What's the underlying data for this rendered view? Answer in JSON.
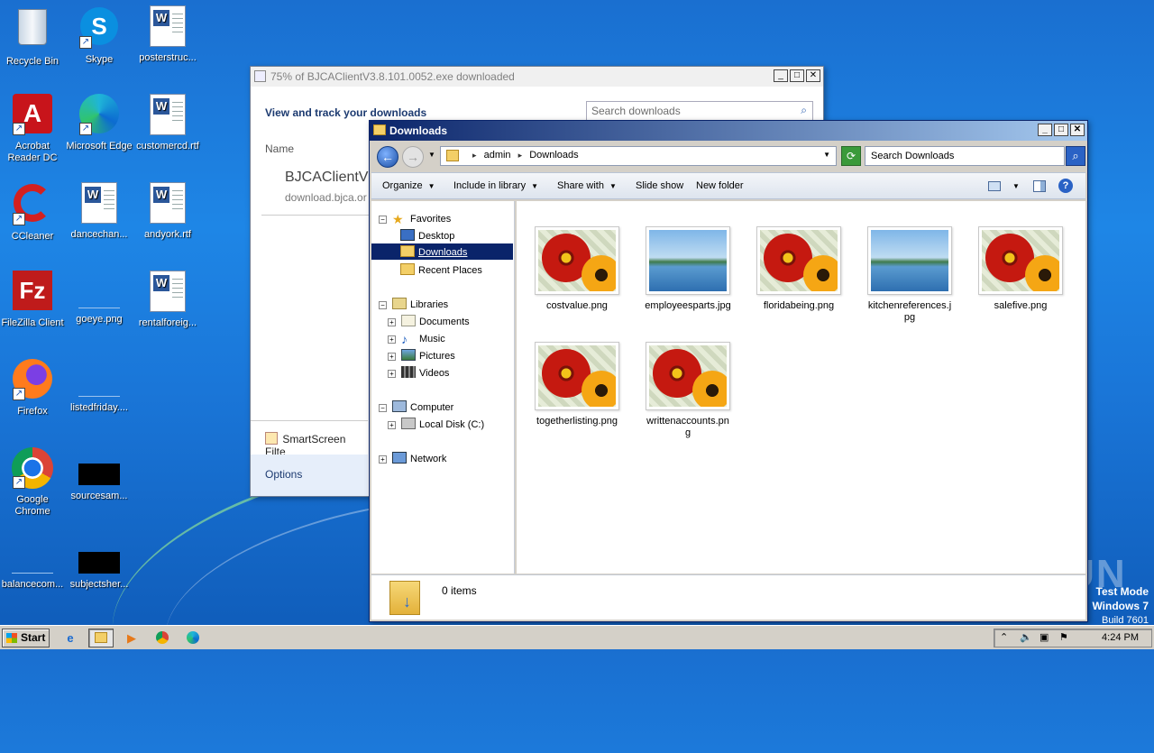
{
  "desktop": {
    "icons": [
      {
        "label": "Recycle Bin"
      },
      {
        "label": "Skype"
      },
      {
        "label": "posterstruc..."
      },
      {
        "label": "Acrobat Reader DC"
      },
      {
        "label": "Microsoft Edge"
      },
      {
        "label": "customercd.rtf"
      },
      {
        "label": "CCleaner"
      },
      {
        "label": "dancechan..."
      },
      {
        "label": "andyork.rtf"
      },
      {
        "label": "FileZilla Client"
      },
      {
        "label": "goeye.png"
      },
      {
        "label": "rentalforeig..."
      },
      {
        "label": "Firefox"
      },
      {
        "label": "listedfriday...."
      },
      {
        "label": "Google Chrome"
      },
      {
        "label": "sourcesam..."
      },
      {
        "label": "balancecom..."
      },
      {
        "label": "subjectsher..."
      }
    ]
  },
  "download_window": {
    "title": "75% of BJCAClientV3.8.101.0052.exe downloaded",
    "heading": "View and track your downloads",
    "search_placeholder": "Search downloads",
    "column_name": "Name",
    "file_name": "BJCAClientV3",
    "file_source": "download.bjca.or",
    "smartscreen": "SmartScreen Filte",
    "options": "Options"
  },
  "explorer": {
    "title": "Downloads",
    "breadcrumb": [
      "admin",
      "Downloads"
    ],
    "search_placeholder": "Search Downloads",
    "commands": [
      "Organize",
      "Include in library",
      "Share with",
      "Slide show",
      "New folder"
    ],
    "nav": {
      "favorites": "Favorites",
      "desktop": "Desktop",
      "downloads": "Downloads",
      "recent": "Recent Places",
      "libraries": "Libraries",
      "documents": "Documents",
      "music": "Music",
      "pictures": "Pictures",
      "videos": "Videos",
      "computer": "Computer",
      "local_disk": "Local Disk (C:)",
      "network": "Network"
    },
    "files": [
      {
        "name": "costvalue.png",
        "kind": "flower"
      },
      {
        "name": "employeesparts.jpg",
        "kind": "lake"
      },
      {
        "name": "floridabeing.png",
        "kind": "flower"
      },
      {
        "name": "kitchenreferences.jpg",
        "kind": "lake"
      },
      {
        "name": "salefive.png",
        "kind": "flower"
      },
      {
        "name": "togetherlisting.png",
        "kind": "flower"
      },
      {
        "name": "writtenaccounts.png",
        "kind": "flower"
      }
    ],
    "status_items": "0 items"
  },
  "taskbar": {
    "start": "Start",
    "clock": "4:24 PM"
  },
  "watermark": {
    "line1": "Test Mode",
    "line2": "Windows 7",
    "line3": "Build 7601",
    "logo": "ANY RUN"
  }
}
